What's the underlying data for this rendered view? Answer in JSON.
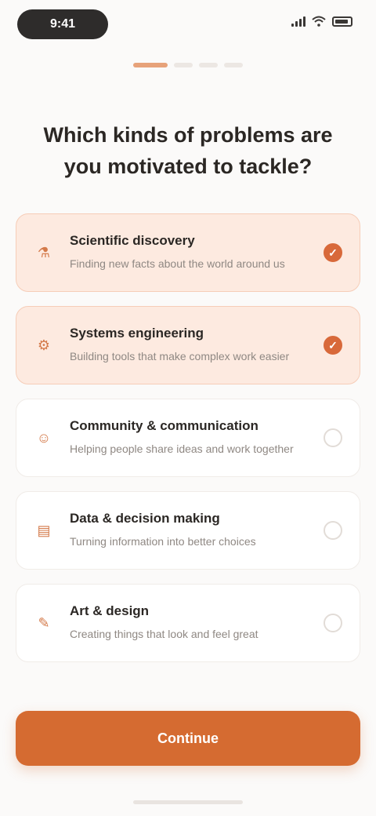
{
  "status_bar": {
    "time": "9:41"
  },
  "progress": {
    "total_steps": 4,
    "completed_steps": 1
  },
  "title": "Which kinds of problems are you motivated to tackle?",
  "options": [
    {
      "icon": "flask-icon",
      "title": "Scientific discovery",
      "desc": "Finding new facts about the world around us",
      "selected": true
    },
    {
      "icon": "gear-icon",
      "title": "Systems engineering",
      "desc": "Building tools that make complex work easier",
      "selected": true
    },
    {
      "icon": "people-icon",
      "title": "Community & communication",
      "desc": "Helping people share ideas and work together",
      "selected": false
    },
    {
      "icon": "chart-icon",
      "title": "Data & decision making",
      "desc": "Turning information into better choices",
      "selected": false
    },
    {
      "icon": "palette-icon",
      "title": "Art & design",
      "desc": "Creating things that look and feel great",
      "selected": false
    }
  ],
  "continue_label": "Continue",
  "colors": {
    "accent": "#d56b31",
    "selected_bg": "#fdeae0"
  }
}
